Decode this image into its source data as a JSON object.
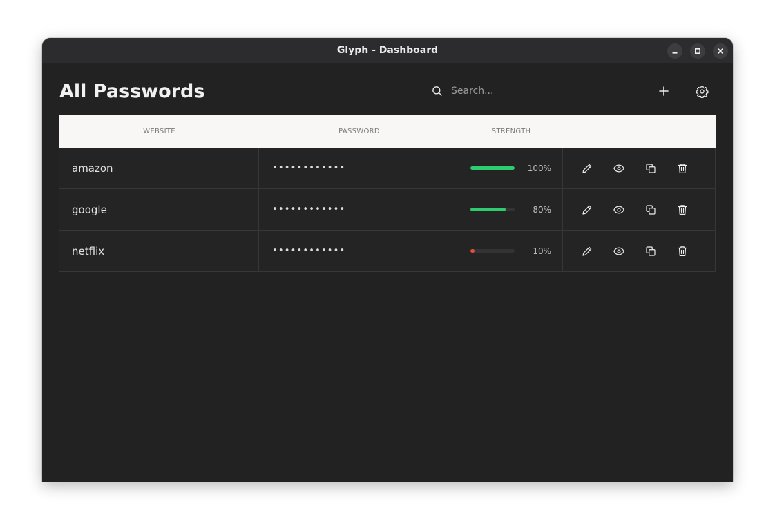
{
  "window": {
    "title": "Glyph - Dashboard"
  },
  "header": {
    "title": "All Passwords",
    "search_placeholder": "Search...",
    "search_value": ""
  },
  "table": {
    "columns": [
      "WEBSITE",
      "PASSWORD",
      "STRENGTH"
    ],
    "rows": [
      {
        "website": "amazon",
        "password": "••••••••••••",
        "strength": 100,
        "strength_label": "100%",
        "strength_color": "#2ecc71"
      },
      {
        "website": "google",
        "password": "••••••••••••",
        "strength": 80,
        "strength_label": "80%",
        "strength_color": "#2ecc71"
      },
      {
        "website": "netflix",
        "password": "••••••••••••",
        "strength": 10,
        "strength_label": "10%",
        "strength_color": "#e74c3c"
      }
    ]
  },
  "icons": {
    "window_controls": [
      "minimize-icon",
      "maximize-icon",
      "close-icon"
    ],
    "header": [
      "search-icon",
      "plus-icon",
      "gear-icon"
    ],
    "row_actions": [
      "pencil-icon",
      "eye-icon",
      "copy-icon",
      "trash-icon"
    ]
  },
  "colors": {
    "background": "#222222",
    "titlebar": "#2c2c2e",
    "table_header": "#f8f7f5",
    "strength_good": "#2ecc71",
    "strength_bad": "#e74c3c"
  }
}
